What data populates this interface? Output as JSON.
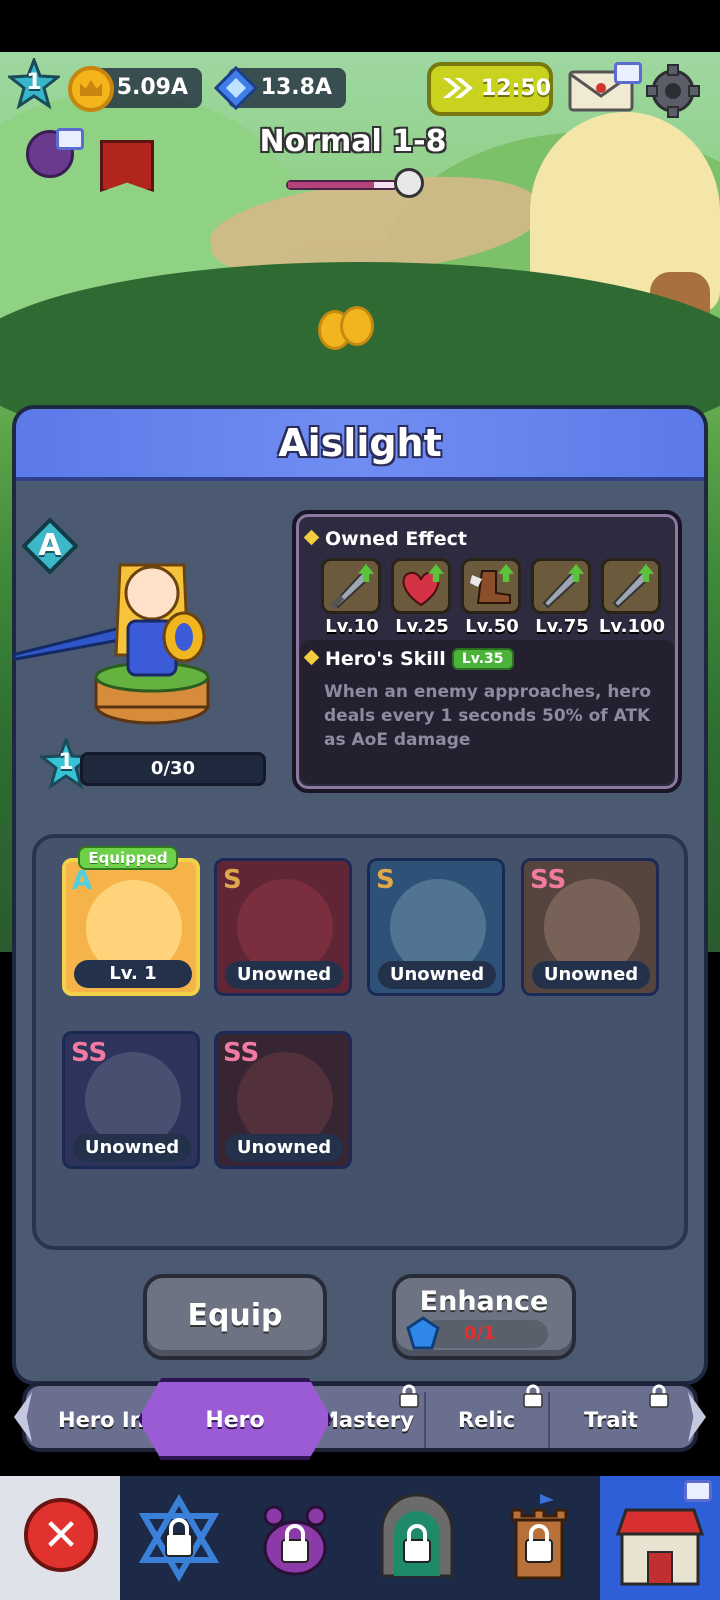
{
  "topbar": {
    "player_level": "1",
    "gold": "5.09A",
    "gems": "13.8A",
    "speed_timer": "12:50"
  },
  "stage": {
    "title": "Normal 1-8",
    "progress": 0.8
  },
  "hero_panel": {
    "name": "Aislight",
    "grade": "A",
    "level": "1",
    "xp": "0/30",
    "owned_effect": {
      "title": "Owned Effect",
      "items": [
        {
          "icon": "sword-icon",
          "level": "Lv.10"
        },
        {
          "icon": "heart-icon",
          "level": "Lv.25"
        },
        {
          "icon": "boot-icon",
          "level": "Lv.50"
        },
        {
          "icon": "sword-icon",
          "level": "Lv.75"
        },
        {
          "icon": "sword-icon",
          "level": "Lv.100"
        }
      ]
    },
    "skill": {
      "title": "Hero's Skill",
      "level": "Lv.35",
      "description": "When an enemy approaches, hero deals every 1 seconds 50% of ATK as AoE damage"
    }
  },
  "heroes": [
    {
      "grade": "A",
      "status": "Lv. 1",
      "badge": "Equipped",
      "color": "#f0a23a"
    },
    {
      "grade": "S",
      "status": "Unowned",
      "color": "#b8343a"
    },
    {
      "grade": "S",
      "status": "Unowned",
      "color": "#6fa7c9"
    },
    {
      "grade": "SS",
      "status": "Unowned",
      "color": "#b58a63"
    },
    {
      "grade": "SS",
      "status": "Unowned",
      "color": "#5b5f78"
    },
    {
      "grade": "SS",
      "status": "Unowned",
      "color": "#7a3a3a"
    }
  ],
  "actions": {
    "equip": "Equip",
    "enhance": "Enhance",
    "enhance_count": "0/1"
  },
  "tabs": [
    "Hero In",
    "Hero",
    "Mastery",
    "Relic",
    "Trait"
  ],
  "nav": [
    "close",
    "summon",
    "pet",
    "dungeon",
    "tower",
    "shop"
  ]
}
